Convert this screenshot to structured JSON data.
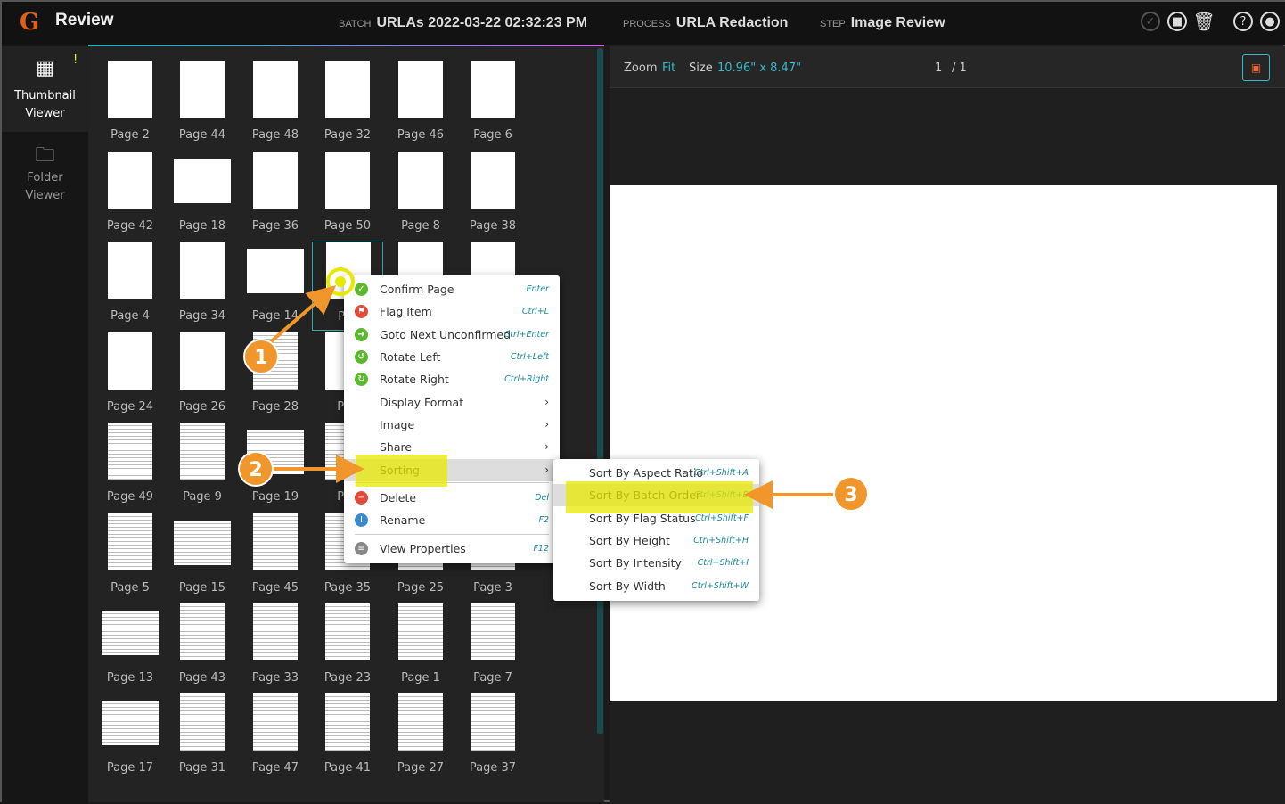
{
  "header": {
    "logo": "G",
    "title": "Review",
    "batch_label": "BATCH",
    "batch": "URLAs 2022-03-22 02:32:23 PM",
    "process_label": "PROCESS",
    "process": "URLA Redaction",
    "step_label": "STEP",
    "step": "Image Review"
  },
  "sidebar": {
    "items": [
      {
        "label1": "Thumbnail",
        "label2": "Viewer",
        "badge": "!"
      },
      {
        "label1": "Folder",
        "label2": "Viewer"
      }
    ]
  },
  "thumbnails": [
    [
      "Page 2",
      "Page 44",
      "Page 48",
      "Page 32",
      "Page 46",
      "Page 6"
    ],
    [
      "Page 42",
      "Page 18",
      "Page 36",
      "Page 50",
      "Page 8",
      "Page 38"
    ],
    [
      "Page 4",
      "Page 34",
      "Page 14",
      "Pag",
      "",
      ""
    ],
    [
      "Page 24",
      "Page 26",
      "Page 28",
      "Pag",
      "",
      ""
    ],
    [
      "Page 49",
      "Page 9",
      "Page 19",
      "Pag",
      "",
      ""
    ],
    [
      "Page 5",
      "Page 15",
      "Page 45",
      "Page 35",
      "Page 25",
      "Page 3"
    ],
    [
      "Page 13",
      "Page 43",
      "Page 33",
      "Page 23",
      "Page 1",
      "Page 7"
    ],
    [
      "Page 17",
      "Page 31",
      "Page 47",
      "Page 41",
      "Page 27",
      "Page 37"
    ]
  ],
  "viewer": {
    "zoom_label": "Zoom",
    "zoom": "Fit",
    "size_label": "Size",
    "size": "10.96\" x 8.47\"",
    "page": "1",
    "total": "/ 1"
  },
  "context_menu": [
    {
      "label": "Confirm Page",
      "shortcut": "Enter",
      "icon": "check-circle-icon",
      "color": "#5cb82e",
      "glyph": "✓"
    },
    {
      "label": "Flag Item",
      "shortcut": "Ctrl+L",
      "icon": "flag-icon",
      "color": "#e04a3a",
      "glyph": "⚑"
    },
    {
      "label": "Goto Next Unconfirmed",
      "shortcut": "Ctrl+Enter",
      "icon": "next-unconfirmed-icon",
      "color": "#5cb82e",
      "glyph": "➜"
    },
    {
      "label": "Rotate Left",
      "shortcut": "Ctrl+Left",
      "icon": "rotate-left-icon",
      "color": "#5cb82e",
      "glyph": "↺"
    },
    {
      "label": "Rotate Right",
      "shortcut": "Ctrl+Right",
      "icon": "rotate-right-icon",
      "color": "#5cb82e",
      "glyph": "↻"
    },
    {
      "label": "Display Format",
      "submenu": true
    },
    {
      "label": "Image",
      "submenu": true
    },
    {
      "label": "Share",
      "submenu": true
    },
    {
      "label": "Sorting",
      "submenu": true
    },
    {
      "label": "Delete",
      "shortcut": "Del",
      "icon": "delete-icon",
      "color": "#e04a3a",
      "glyph": "−"
    },
    {
      "label": "Rename",
      "shortcut": "F2",
      "icon": "rename-icon",
      "color": "#3a8ad0",
      "glyph": "I"
    },
    {
      "label": "View Properties",
      "shortcut": "F12",
      "icon": "properties-icon",
      "color": "#888",
      "glyph": "≡"
    }
  ],
  "sorting_menu": [
    {
      "label": "Sort By Aspect Ratio",
      "shortcut": "Ctrl+Shift+A"
    },
    {
      "label": "Sort By Batch Order",
      "shortcut": "Ctrl+Shift+B"
    },
    {
      "label": "Sort By Flag Status",
      "shortcut": "Ctrl+Shift+F"
    },
    {
      "label": "Sort By Height",
      "shortcut": "Ctrl+Shift+H"
    },
    {
      "label": "Sort By Intensity",
      "shortcut": "Ctrl+Shift+I"
    },
    {
      "label": "Sort By Width",
      "shortcut": "Ctrl+Shift+W"
    }
  ],
  "annotations": [
    "1",
    "2",
    "3"
  ],
  "colors": {
    "accent": "#33bbcc",
    "highlight": "#e8e800",
    "arrow": "#f0962a"
  }
}
